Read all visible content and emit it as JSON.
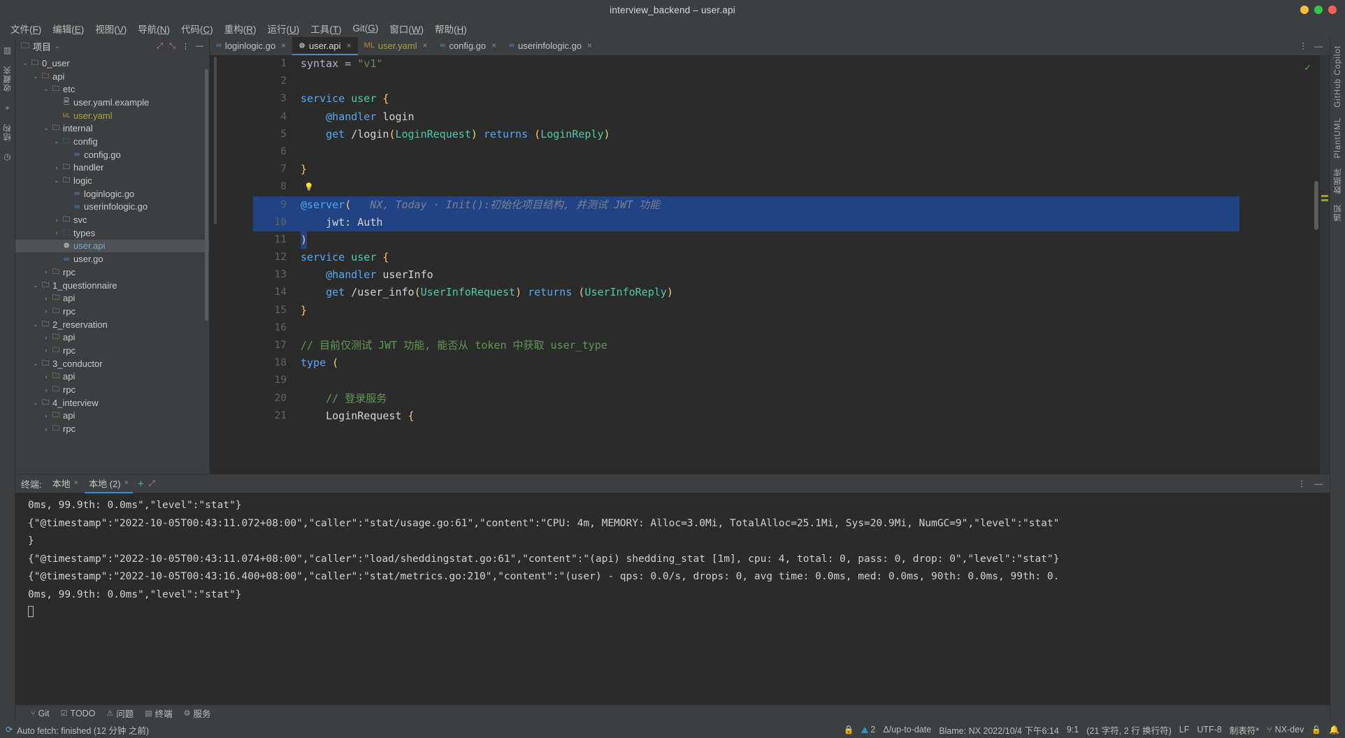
{
  "window": {
    "title": "interview_backend – user.api",
    "buttons": [
      {
        "name": "minimize",
        "color": "#fdbc40"
      },
      {
        "name": "maximize",
        "color": "#34c84a"
      },
      {
        "name": "close",
        "color": "#fc615d"
      }
    ]
  },
  "menubar": {
    "items": [
      {
        "label": "文件(F)",
        "mnemonic": "F"
      },
      {
        "label": "编辑(E)",
        "mnemonic": "E"
      },
      {
        "label": "视图(V)",
        "mnemonic": "V"
      },
      {
        "label": "导航(N)",
        "mnemonic": "N"
      },
      {
        "label": "代码(C)",
        "mnemonic": "C"
      },
      {
        "label": "重构(R)",
        "mnemonic": "R"
      },
      {
        "label": "运行(U)",
        "mnemonic": "U"
      },
      {
        "label": "工具(T)",
        "mnemonic": "T"
      },
      {
        "label": "Git(G)",
        "mnemonic": "G"
      },
      {
        "label": "窗口(W)",
        "mnemonic": "W"
      },
      {
        "label": "帮助(H)",
        "mnemonic": "H"
      }
    ]
  },
  "left_strip": {
    "tabs": [
      "项目",
      "收藏夹",
      "结构"
    ],
    "bottom_icon": "clock-icon"
  },
  "right_strip": {
    "tabs": [
      "GitHub Copilot",
      "PlantUML",
      "数据库",
      "通知"
    ]
  },
  "project_panel": {
    "title": "项目",
    "chevron": "chevron-down-icon",
    "actions": [
      "expand-all-icon",
      "collapse-all-icon",
      "more-options-icon",
      "hide-icon"
    ],
    "tree": [
      {
        "indent": 1,
        "arrow": "down",
        "icon": "folder",
        "label": "0_user",
        "selected": false
      },
      {
        "indent": 2,
        "arrow": "down",
        "icon": "folder-yellow",
        "label": "api",
        "selected": false
      },
      {
        "indent": 3,
        "arrow": "down",
        "icon": "folder",
        "label": "etc",
        "selected": false
      },
      {
        "indent": 4,
        "arrow": "none",
        "icon": "file-doc",
        "label": "user.yaml.example",
        "selected": false
      },
      {
        "indent": 4,
        "arrow": "none",
        "icon": "file-yaml",
        "label": "user.yaml",
        "selected": false,
        "color": "#a9a13b"
      },
      {
        "indent": 3,
        "arrow": "down",
        "icon": "folder",
        "label": "internal",
        "selected": false
      },
      {
        "indent": 4,
        "arrow": "down",
        "icon": "folder-cfg",
        "label": "config",
        "selected": false
      },
      {
        "indent": 5,
        "arrow": "none",
        "icon": "file-go",
        "label": "config.go",
        "selected": false
      },
      {
        "indent": 4,
        "arrow": "right",
        "icon": "folder",
        "label": "handler",
        "selected": false
      },
      {
        "indent": 4,
        "arrow": "down",
        "icon": "folder",
        "label": "logic",
        "selected": false
      },
      {
        "indent": 5,
        "arrow": "none",
        "icon": "file-go",
        "label": "loginlogic.go",
        "selected": false
      },
      {
        "indent": 5,
        "arrow": "none",
        "icon": "file-go",
        "label": "userinfologic.go",
        "selected": false
      },
      {
        "indent": 4,
        "arrow": "right",
        "icon": "folder",
        "label": "svc",
        "selected": false
      },
      {
        "indent": 4,
        "arrow": "right",
        "icon": "folder-ts",
        "label": "types",
        "selected": false
      },
      {
        "indent": 4,
        "arrow": "none",
        "icon": "file-api",
        "label": "user.api",
        "selected": true,
        "color": "#7aa3cc"
      },
      {
        "indent": 4,
        "arrow": "none",
        "icon": "file-go",
        "label": "user.go",
        "selected": false
      },
      {
        "indent": 3,
        "arrow": "right",
        "icon": "folder",
        "label": "rpc",
        "selected": false
      },
      {
        "indent": 2,
        "arrow": "down",
        "icon": "folder",
        "label": "1_questionnaire",
        "selected": false
      },
      {
        "indent": 3,
        "arrow": "right",
        "icon": "folder-yellow",
        "label": "api",
        "selected": false
      },
      {
        "indent": 3,
        "arrow": "right",
        "icon": "folder",
        "label": "rpc",
        "selected": false
      },
      {
        "indent": 2,
        "arrow": "down",
        "icon": "folder",
        "label": "2_reservation",
        "selected": false
      },
      {
        "indent": 3,
        "arrow": "right",
        "icon": "folder-yellow",
        "label": "api",
        "selected": false
      },
      {
        "indent": 3,
        "arrow": "right",
        "icon": "folder",
        "label": "rpc",
        "selected": false
      },
      {
        "indent": 2,
        "arrow": "down",
        "icon": "folder",
        "label": "3_conductor",
        "selected": false
      },
      {
        "indent": 3,
        "arrow": "right",
        "icon": "folder-yellow",
        "label": "api",
        "selected": false
      },
      {
        "indent": 3,
        "arrow": "right",
        "icon": "folder",
        "label": "rpc",
        "selected": false
      },
      {
        "indent": 2,
        "arrow": "down",
        "icon": "folder",
        "label": "4_interview",
        "selected": false
      },
      {
        "indent": 3,
        "arrow": "right",
        "icon": "folder-yellow",
        "label": "api",
        "selected": false
      },
      {
        "indent": 3,
        "arrow": "right",
        "icon": "folder",
        "label": "rpc",
        "selected": false
      }
    ]
  },
  "editor_tabs": [
    {
      "label": "loginlogic.go",
      "icon": "go-icon",
      "active": false,
      "closable": true
    },
    {
      "label": "user.api",
      "icon": "api-icon",
      "active": true,
      "closable": true
    },
    {
      "label": "user.yaml",
      "icon": "yaml-icon",
      "active": false,
      "closable": true,
      "color": "#a9a13b"
    },
    {
      "label": "config.go",
      "icon": "go-icon",
      "active": false,
      "closable": true
    },
    {
      "label": "userinfologic.go",
      "icon": "go-icon",
      "active": false,
      "closable": true
    }
  ],
  "editor": {
    "inspection_status": "check-ok-icon",
    "lines": [
      {
        "n": "1",
        "tokens": [
          {
            "t": "syntax ",
            "c": "def"
          },
          {
            "t": "= ",
            "c": "def"
          },
          {
            "t": "\"v1\"",
            "c": "str"
          }
        ]
      },
      {
        "n": "2",
        "tokens": []
      },
      {
        "n": "3",
        "tokens": [
          {
            "t": "service ",
            "c": "fn"
          },
          {
            "t": "user ",
            "c": "tp"
          },
          {
            "t": "{",
            "c": "yel"
          }
        ]
      },
      {
        "n": "4",
        "tokens": [
          {
            "t": "    ",
            "c": "def"
          },
          {
            "t": "@handler ",
            "c": "fn"
          },
          {
            "t": "login",
            "c": "white"
          }
        ]
      },
      {
        "n": "5",
        "tokens": [
          {
            "t": "    ",
            "c": "def"
          },
          {
            "t": "get ",
            "c": "fn"
          },
          {
            "t": "/login",
            "c": "white"
          },
          {
            "t": "(",
            "c": "yel"
          },
          {
            "t": "LoginRequest",
            "c": "tp"
          },
          {
            "t": ") ",
            "c": "yel"
          },
          {
            "t": "returns ",
            "c": "fn"
          },
          {
            "t": "(",
            "c": "yel"
          },
          {
            "t": "LoginReply",
            "c": "tp"
          },
          {
            "t": ")",
            "c": "yel"
          }
        ]
      },
      {
        "n": "6",
        "tokens": []
      },
      {
        "n": "7",
        "tokens": [
          {
            "t": "}",
            "c": "yel"
          }
        ]
      },
      {
        "n": "8",
        "tokens": [],
        "bulb": true
      },
      {
        "n": "9",
        "tokens": [
          {
            "t": "@server",
            "c": "fn"
          },
          {
            "t": "(",
            "c": "yel"
          }
        ],
        "inlay": "   NX, Today · Init():初始化项目结构, 并测试 JWT 功能",
        "highlight": true
      },
      {
        "n": "10",
        "tokens": [
          {
            "t": "    jwt: Auth",
            "c": "white"
          }
        ],
        "highlight": true
      },
      {
        "n": "11",
        "tokens": [
          {
            "t": ")",
            "c": "yel"
          }
        ],
        "highlight_caret": true
      },
      {
        "n": "12",
        "tokens": [
          {
            "t": "service ",
            "c": "fn"
          },
          {
            "t": "user ",
            "c": "tp"
          },
          {
            "t": "{",
            "c": "yel"
          }
        ]
      },
      {
        "n": "13",
        "tokens": [
          {
            "t": "    ",
            "c": "def"
          },
          {
            "t": "@handler ",
            "c": "fn"
          },
          {
            "t": "userInfo",
            "c": "white"
          }
        ]
      },
      {
        "n": "14",
        "tokens": [
          {
            "t": "    ",
            "c": "def"
          },
          {
            "t": "get ",
            "c": "fn"
          },
          {
            "t": "/user_info",
            "c": "white"
          },
          {
            "t": "(",
            "c": "yel"
          },
          {
            "t": "UserInfoRequest",
            "c": "tp"
          },
          {
            "t": ") ",
            "c": "yel"
          },
          {
            "t": "returns ",
            "c": "fn"
          },
          {
            "t": "(",
            "c": "yel"
          },
          {
            "t": "UserInfoReply",
            "c": "tp"
          },
          {
            "t": ")",
            "c": "yel"
          }
        ]
      },
      {
        "n": "15",
        "tokens": [
          {
            "t": "}",
            "c": "yel"
          }
        ]
      },
      {
        "n": "16",
        "tokens": []
      },
      {
        "n": "17",
        "tokens": [
          {
            "t": "// 目前仅测试 JWT 功能, 能否从 token 中获取 user_type",
            "c": "com"
          }
        ]
      },
      {
        "n": "18",
        "tokens": [
          {
            "t": "type ",
            "c": "fn"
          },
          {
            "t": "(",
            "c": "yel"
          }
        ]
      },
      {
        "n": "19",
        "tokens": []
      },
      {
        "n": "20",
        "tokens": [
          {
            "t": "    // 登录服务",
            "c": "com"
          }
        ]
      },
      {
        "n": "21",
        "tokens": [
          {
            "t": "    ",
            "c": "def"
          },
          {
            "t": "LoginRequest ",
            "c": "white"
          },
          {
            "t": "{",
            "c": "yel"
          }
        ]
      }
    ]
  },
  "terminal": {
    "label": "终端:",
    "tabs": [
      {
        "label": "本地",
        "active": false,
        "closable": true
      },
      {
        "label": "本地 (2)",
        "active": true,
        "closable": true
      }
    ],
    "new_tab_icon": "plus-icon",
    "expand_icon": "expand-icon",
    "more_icon": "more-options-icon",
    "hide_icon": "hide-icon",
    "output": [
      "0ms, 99.9th: 0.0ms\",\"level\":\"stat\"}",
      "{\"@timestamp\":\"2022-10-05T00:43:11.072+08:00\",\"caller\":\"stat/usage.go:61\",\"content\":\"CPU: 4m, MEMORY: Alloc=3.0Mi, TotalAlloc=25.1Mi, Sys=20.9Mi, NumGC=9\",\"level\":\"stat\"",
      "}",
      "{\"@timestamp\":\"2022-10-05T00:43:11.074+08:00\",\"caller\":\"load/sheddingstat.go:61\",\"content\":\"(api) shedding_stat [1m], cpu: 4, total: 0, pass: 0, drop: 0\",\"level\":\"stat\"}",
      "{\"@timestamp\":\"2022-10-05T00:43:16.400+08:00\",\"caller\":\"stat/metrics.go:210\",\"content\":\"(user) - qps: 0.0/s, drops: 0, avg time: 0.0ms, med: 0.0ms, 90th: 0.0ms, 99th: 0.",
      "0ms, 99.9th: 0.0ms\",\"level\":\"stat\"}"
    ]
  },
  "bottom_toolwindows": [
    {
      "label": "Git",
      "icon": "git-icon"
    },
    {
      "label": "TODO",
      "icon": "todo-icon"
    },
    {
      "label": "问题",
      "icon": "problems-icon"
    },
    {
      "label": "终端",
      "icon": "terminal-icon"
    },
    {
      "label": "服务",
      "icon": "services-icon"
    }
  ],
  "statusbar": {
    "left_icon": "sync-icon",
    "message": "Auto fetch: finished (12 分钟 之前)",
    "lock_icon": "lock-icon",
    "warning_count": "2",
    "git_status": "Δ/up-to-date",
    "blame": "Blame: NX 2022/10/4 下午6:14",
    "caret": "9:1",
    "selection": "(21 字符, 2 行 换行符)",
    "line_separator": "LF",
    "encoding": "UTF-8",
    "indent": "制表符*",
    "branch_icon": "branch-icon",
    "branch": "NX-dev",
    "bottom_right_icons": [
      "lock-icon",
      "notifications-icon"
    ]
  }
}
